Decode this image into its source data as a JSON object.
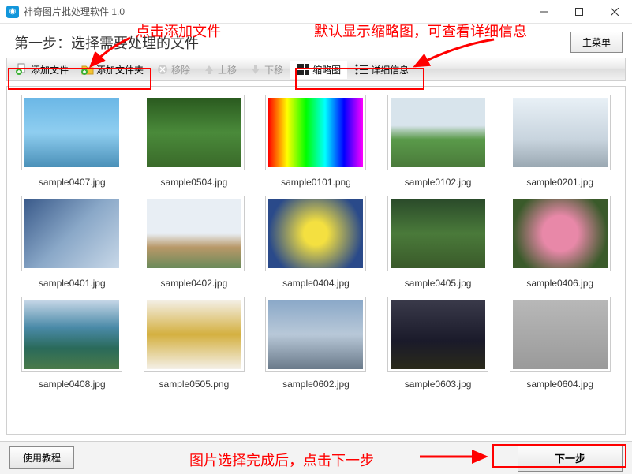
{
  "titlebar": {
    "title": "神奇图片批处理软件 1.0"
  },
  "step": {
    "title": "第一步：选择需要处理的文件",
    "main_menu": "主菜单"
  },
  "toolbar": {
    "add_file": "添加文件",
    "add_folder": "添加文件夹",
    "remove": "移除",
    "move_up": "上移",
    "move_down": "下移",
    "thumbnail": "缩略图",
    "detail": "详细信息"
  },
  "annotations": {
    "click_add": "点击添加文件",
    "default_thumb": "默认显示缩略图，可查看详细信息",
    "after_select": "图片选择完成后，点击下一步"
  },
  "thumbnails": [
    {
      "name": "sample0407.jpg",
      "bg": "linear-gradient(180deg,#6bb7e6 0%,#8fcef0 50%,#4a90b8 100%)"
    },
    {
      "name": "sample0504.jpg",
      "bg": "linear-gradient(180deg,#2a5a1f 0%,#4a8a3a 50%,#3a6a2a 100%)"
    },
    {
      "name": "sample0101.png",
      "bg": "linear-gradient(90deg,#ff0000,#ffff00,#00ff00,#00ffff,#0000ff,#ff00ff)"
    },
    {
      "name": "sample0102.jpg",
      "bg": "linear-gradient(180deg,#d8e4ec 0%,#d8e4ec 40%,#5a9a4a 60%,#4a7a3a 100%)"
    },
    {
      "name": "sample0201.jpg",
      "bg": "linear-gradient(180deg,#e8f0f6 0%,#c8d4de 60%,#9aa8b2 100%)"
    },
    {
      "name": "sample0401.jpg",
      "bg": "linear-gradient(135deg,#3a5a8a 0%,#8aa8c8 50%,#c8d8e8 100%)"
    },
    {
      "name": "sample0402.jpg",
      "bg": "linear-gradient(180deg,#e8eef4 0%,#e8eef4 50%,#b89868 70%,#6a8a5a 100%)"
    },
    {
      "name": "sample0404.jpg",
      "bg": "radial-gradient(circle,#f4e040 20%,#2a4a8a 80%)"
    },
    {
      "name": "sample0405.jpg",
      "bg": "linear-gradient(180deg,#2a4a2a 0%,#4a7a3a 50%,#3a5a2a 100%)"
    },
    {
      "name": "sample0406.jpg",
      "bg": "radial-gradient(circle,#e888a8 30%,#3a5a2a 80%)"
    },
    {
      "name": "sample0408.jpg",
      "bg": "linear-gradient(180deg,#c8d8e8 0%,#4a8aa8 40%,#2a6a5a 70%,#4a7a4a 100%)"
    },
    {
      "name": "sample0505.png",
      "bg": "linear-gradient(180deg,#f4f0e8 0%,#d4b040 50%,#f4f0e8 100%)"
    },
    {
      "name": "sample0602.jpg",
      "bg": "linear-gradient(180deg,#8aa8c8 0%,#b8c8d8 50%,#6a7a8a 100%)"
    },
    {
      "name": "sample0603.jpg",
      "bg": "linear-gradient(180deg,#3a3a4a 0%,#1a1a2a 60%,#2a2a1a 100%)"
    },
    {
      "name": "sample0604.jpg",
      "bg": "linear-gradient(180deg,#b8b8b8 0%,#9a9a9a 100%)"
    }
  ],
  "footer": {
    "tutorial": "使用教程",
    "next": "下一步"
  }
}
